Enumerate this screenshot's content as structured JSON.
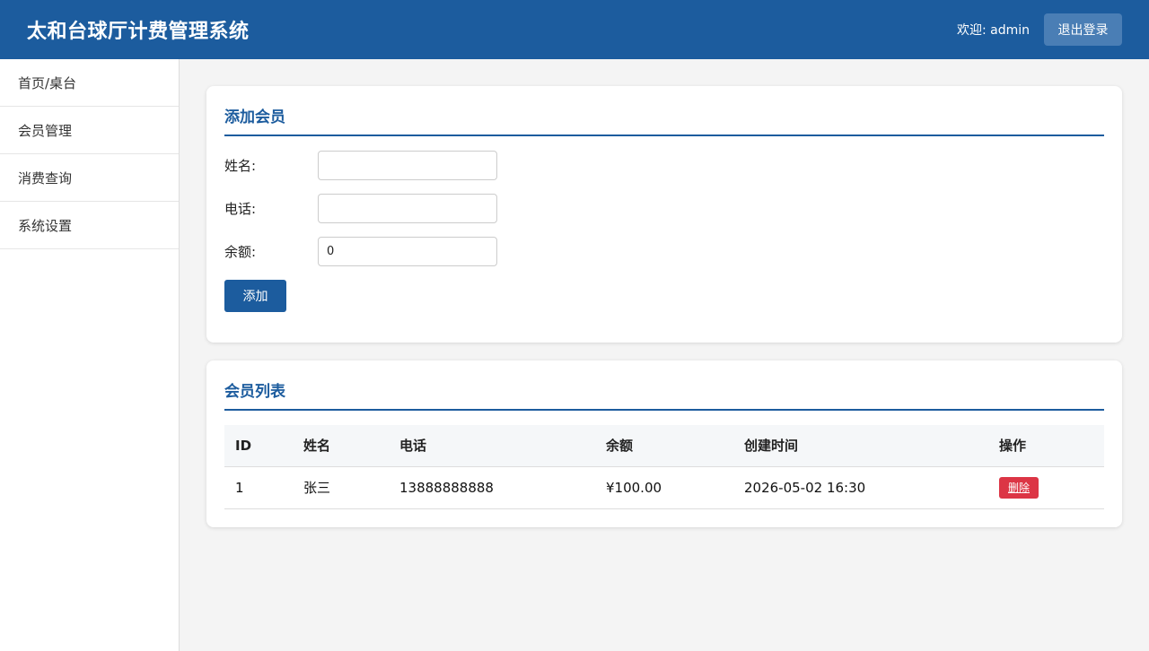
{
  "header": {
    "title": "太和台球厅计费管理系统",
    "welcome": "欢迎: admin",
    "logout_label": "退出登录"
  },
  "sidebar": {
    "items": [
      {
        "label": "首页/桌台"
      },
      {
        "label": "会员管理"
      },
      {
        "label": "消费查询"
      },
      {
        "label": "系统设置"
      }
    ]
  },
  "add_member": {
    "title": "添加会员",
    "name_label": "姓名:",
    "name_value": "",
    "phone_label": "电话:",
    "phone_value": "",
    "balance_label": "余额:",
    "balance_value": "0",
    "submit_label": "添加"
  },
  "member_list": {
    "title": "会员列表",
    "columns": [
      "ID",
      "姓名",
      "电话",
      "余额",
      "创建时间",
      "操作"
    ],
    "rows": [
      {
        "id": "1",
        "name": "张三",
        "phone": "13888888888",
        "balance": "¥100.00",
        "created": "2026-05-02 16:30",
        "action": "删除"
      }
    ]
  },
  "colors": {
    "primary": "#1c5c9e",
    "danger": "#dc3545",
    "background": "#f4f4f4"
  }
}
